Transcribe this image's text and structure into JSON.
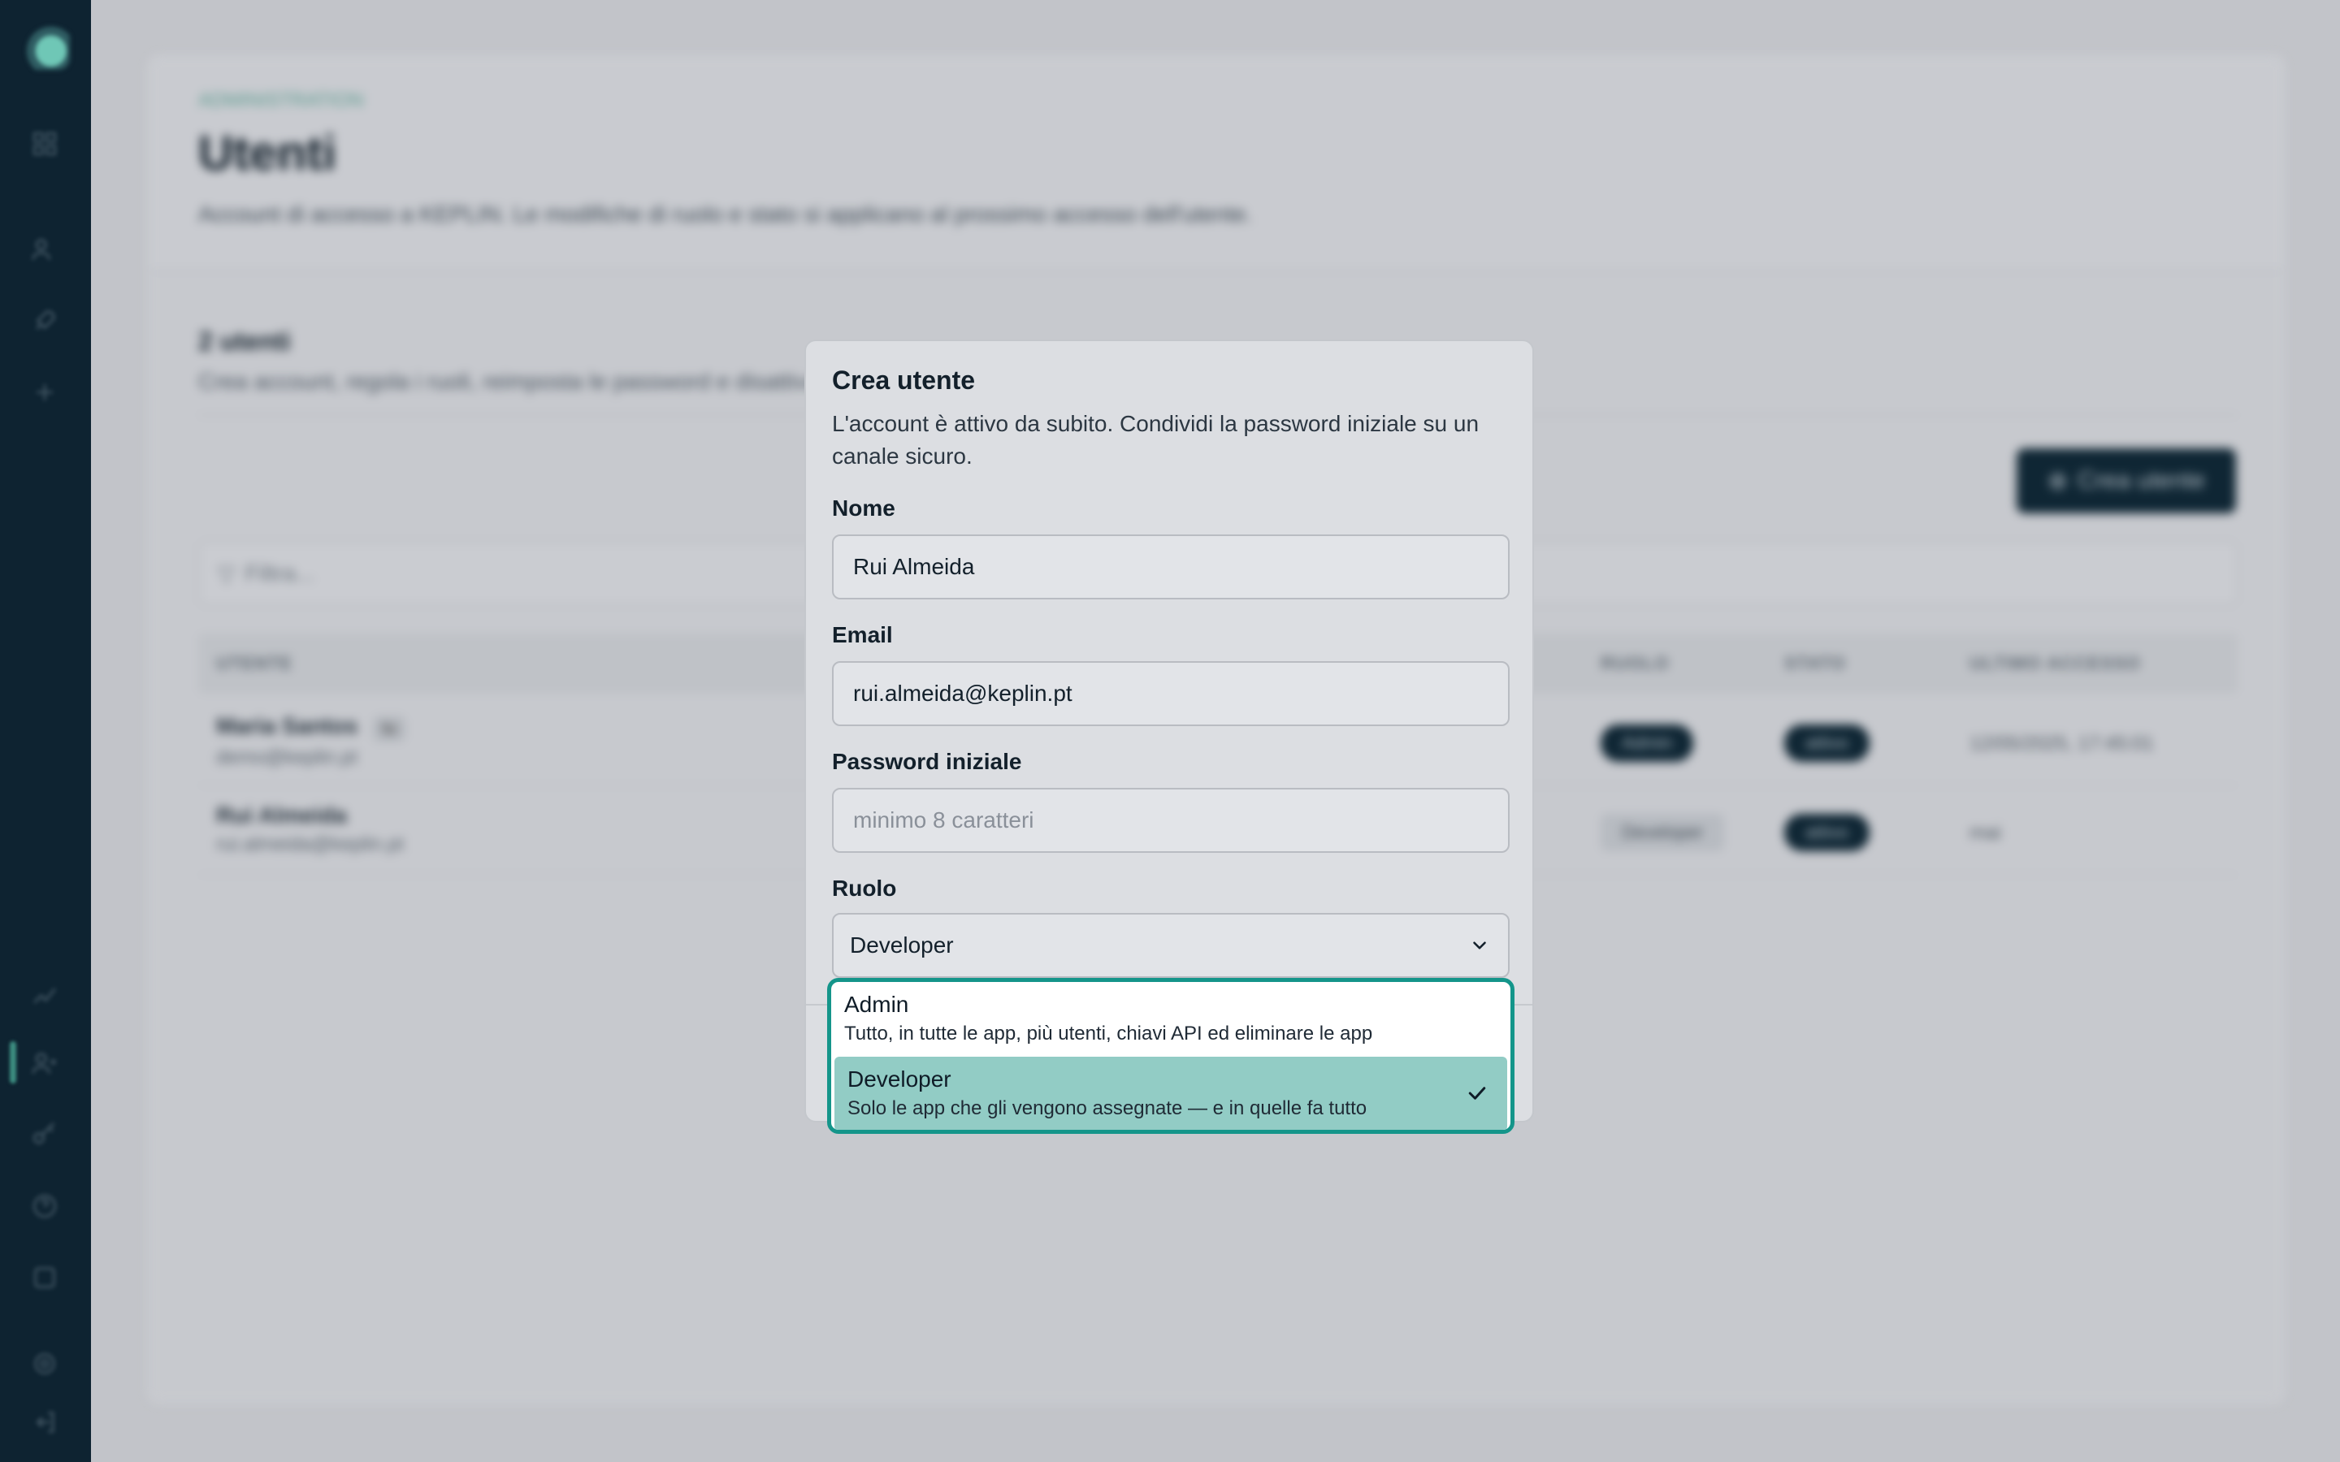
{
  "sidebar": {
    "icons": [
      "logo-icon",
      "grid-icon",
      "users-icon",
      "rocket-icon",
      "plus-icon",
      "chart-icon",
      "users-admin-icon",
      "key-icon",
      "help-icon",
      "settings-icon",
      "gear-icon",
      "logout-icon"
    ]
  },
  "background": {
    "breadcrumb": "ADMINISTRATION",
    "title": "Utenti",
    "subtitle": "Account di accesso a KEPLIN. Le modifiche di ruolo e stato si applicano al prossimo accesso dell'utente.",
    "section_title": "2 utenti",
    "section_subtitle": "Crea account, regola i ruoli, reimposta le password e disattiva gli accessi.",
    "create_button": "Crea utente",
    "filter_placeholder": "Filtra...",
    "columns": [
      "UTENTE",
      "RUOLO",
      "STATO",
      "ULTIMO ACCESSO"
    ],
    "rows": [
      {
        "name": "Maria Santos",
        "you_badge": "tu",
        "email": "demo@keplin.pt",
        "role": "Admin",
        "status": "attivo",
        "last_login": "12/05/2025, 17:45:01"
      },
      {
        "name": "Rui Almeida",
        "email": "rui.almeida@keplin.pt",
        "role": "Developer",
        "status": "attivo",
        "last_login": "mai"
      }
    ]
  },
  "dialog": {
    "title": "Crea utente",
    "description": "L'account è attivo da subito. Condividi la password iniziale su un canale sicuro.",
    "name_label": "Nome",
    "name_value": "Rui Almeida",
    "email_label": "Email",
    "email_value": "rui.almeida@keplin.pt",
    "password_label": "Password iniziale",
    "password_placeholder": "minimo 8 caratteri",
    "role_label": "Ruolo",
    "role_value": "Developer"
  },
  "role_options": [
    {
      "title": "Admin",
      "description": "Tutto, in tutte le app, più utenti, chiavi API ed eliminare le app",
      "selected": false
    },
    {
      "title": "Developer",
      "description": "Solo le app che gli vengono assegnate — e in quelle fa tutto",
      "selected": true
    }
  ],
  "colors": {
    "sidebar": "#0e2331",
    "accent": "#14958a",
    "selected_option": "#92ccc5"
  }
}
